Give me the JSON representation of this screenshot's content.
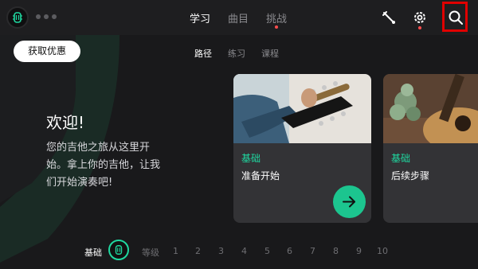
{
  "header": {
    "tabs": [
      {
        "label": "学习",
        "active": true
      },
      {
        "label": "曲目",
        "active": false
      },
      {
        "label": "挑战",
        "active": false,
        "notification": true
      }
    ],
    "icons": [
      "guitar-tuner-icon",
      "gear-icon",
      "search-icon"
    ]
  },
  "offer_button": "获取优惠",
  "sub_tabs": [
    {
      "label": "路径",
      "active": true
    },
    {
      "label": "练习",
      "active": false
    },
    {
      "label": "课程",
      "active": false
    }
  ],
  "welcome": {
    "title": "欢迎!",
    "line1": "您的吉他之旅从这里开",
    "line2": "始。拿上你的吉他，让我",
    "line3": "们开始演奏吧!"
  },
  "cards": [
    {
      "level": "基础",
      "title": "准备开始",
      "has_go_button": true
    },
    {
      "level": "基础",
      "title": "后续步骤",
      "has_go_button": false
    }
  ],
  "level_bar": {
    "current": "基础",
    "label": "等级",
    "levels": [
      "1",
      "2",
      "3",
      "4",
      "5",
      "6",
      "7",
      "8",
      "9",
      "10"
    ]
  },
  "colors": {
    "accent": "#1fd8a0",
    "go_button": "#1cc58f",
    "background": "#19191b",
    "card": "#333336",
    "notification": "#ff4d4d",
    "highlight_box": "#e00000"
  }
}
